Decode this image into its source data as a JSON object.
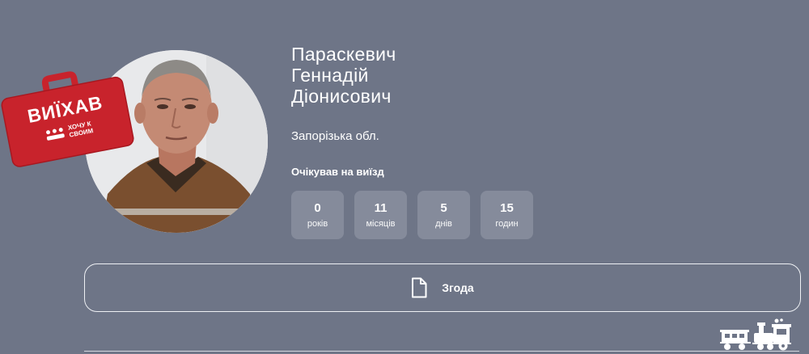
{
  "person": {
    "last_name": "Параскевич",
    "first_name": "Геннадій",
    "patronymic": "Діонисович",
    "region": "Запорізька обл."
  },
  "badge": {
    "title": "ВИЇХАВ",
    "subtitle_line1": "ХОЧУ К",
    "subtitle_line2": "СВОИМ",
    "color": "#c8232c"
  },
  "waiting": {
    "label": "Очікував на виїзд",
    "stats": [
      {
        "value": "0",
        "unit": "років"
      },
      {
        "value": "11",
        "unit": "місяців"
      },
      {
        "value": "5",
        "unit": "днів"
      },
      {
        "value": "15",
        "unit": "годин"
      }
    ]
  },
  "consent": {
    "label": "Згода",
    "icon": "document-icon"
  },
  "footer": {
    "icon": "train-icon"
  },
  "colors": {
    "background": "#6e7587",
    "stat_box": "#858b9b",
    "text": "#ffffff"
  }
}
